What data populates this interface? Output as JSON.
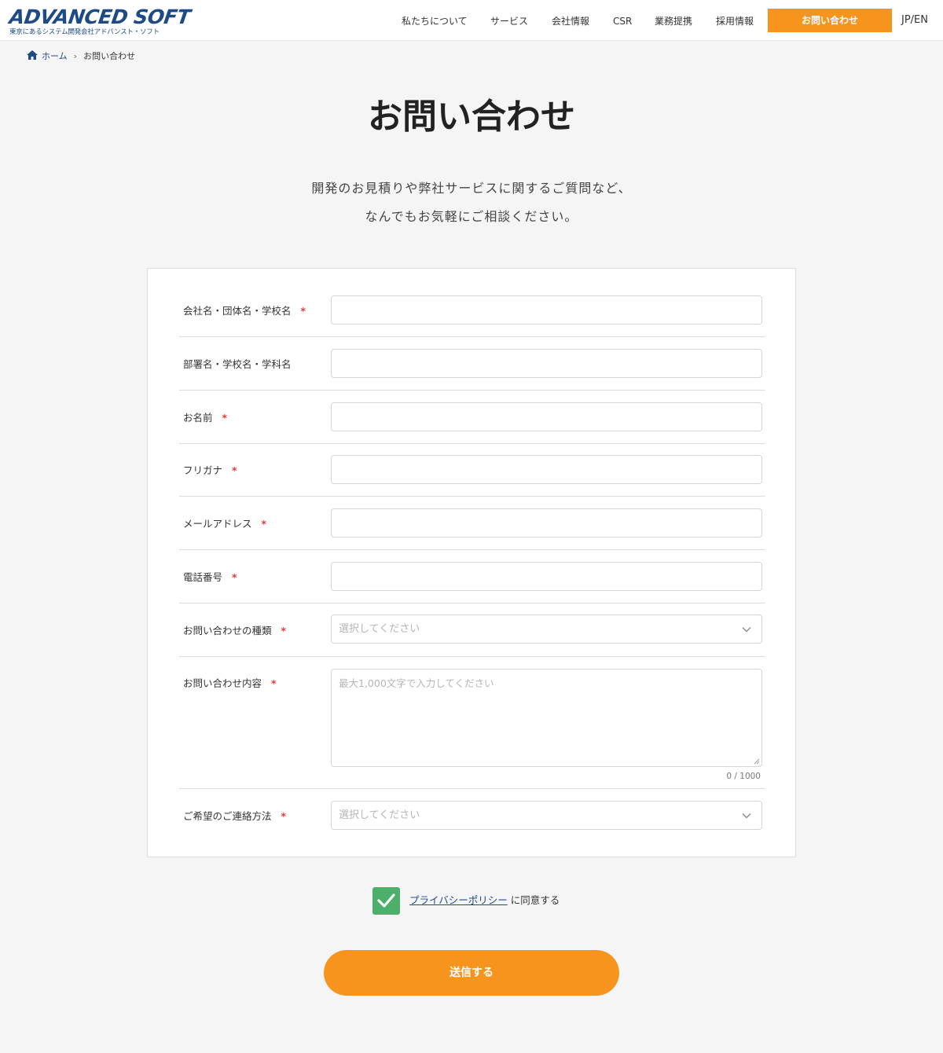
{
  "header": {
    "logo_main": "ADVANCED SOFT",
    "logo_sub": "東京にあるシステム開発会社アドバンスト・ソフト",
    "nav": [
      {
        "label": "私たちについて"
      },
      {
        "label": "サービス"
      },
      {
        "label": "会社情報"
      },
      {
        "label": "CSR"
      },
      {
        "label": "業務提携"
      },
      {
        "label": "採用情報"
      }
    ],
    "contact_button": "お問い合わせ",
    "lang": "JP/EN"
  },
  "breadcrumb": {
    "home": "ホーム",
    "separator": "›",
    "current": "お問い合わせ"
  },
  "title": "お問い合わせ",
  "lead": {
    "line1": "開発のお見積りや弊社サービスに関するご質問など、",
    "line2": "なんでもお気軽にご相談ください。"
  },
  "form": {
    "required_mark": "*",
    "company": {
      "label": "会社名・団体名・学校名",
      "value": ""
    },
    "department": {
      "label": "部署名・学校名・学科名",
      "value": ""
    },
    "name": {
      "label": "お名前",
      "value": ""
    },
    "furigana": {
      "label": "フリガナ",
      "value": ""
    },
    "email": {
      "label": "メールアドレス",
      "value": ""
    },
    "phone": {
      "label": "電話番号",
      "value": ""
    },
    "inquiry_type": {
      "label": "お問い合わせの種類",
      "placeholder": "選択してください"
    },
    "inquiry_content": {
      "label": "お問い合わせ内容",
      "placeholder": "最大1,000文字で入力してください",
      "counter": "0 / 1000"
    },
    "contact_method": {
      "label": "ご希望のご連絡方法",
      "placeholder": "選択してください"
    }
  },
  "agree": {
    "checked": true,
    "link": "プライバシーポリシー",
    "suffix": "に同意する"
  },
  "submit": "送信する",
  "colors": {
    "accent": "#f7941d",
    "brand": "#1e4a86",
    "required": "#e53935",
    "check": "#4caf6a"
  }
}
